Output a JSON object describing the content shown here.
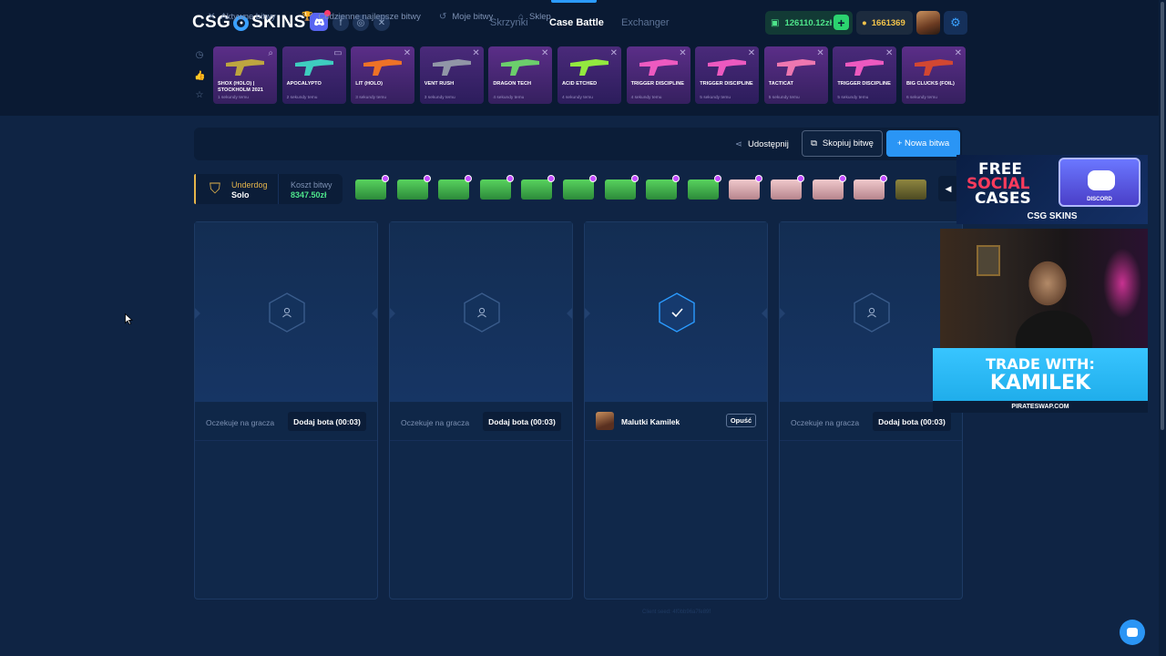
{
  "header": {
    "logo_left": "CSG",
    "logo_right": "SKINS",
    "nav": [
      "Skrzynki",
      "Case Battle",
      "Exchanger"
    ],
    "active_nav": "Case Battle",
    "balance": "126110.12zł",
    "coins": "1661369",
    "social_icons": [
      "discord-icon",
      "facebook-icon",
      "instagram-icon",
      "x-icon"
    ]
  },
  "quick_icons": [
    "clock-icon",
    "thumbs-up-icon",
    "star-icon"
  ],
  "drops": [
    {
      "name": "SHOX (HOLO) | STOCKHOLM 2021",
      "sub": "1 sekundy temu",
      "icon": "pin-icon"
    },
    {
      "name": "APOCALYPTO",
      "sub": "2 sekundy temu",
      "icon": "box-icon"
    },
    {
      "name": "LIT (HOLO)",
      "sub": "3 sekundy temu",
      "icon": "x-icon"
    },
    {
      "name": "VENT RUSH",
      "sub": "3 sekundy temu",
      "icon": "x-icon"
    },
    {
      "name": "DRAGON TECH",
      "sub": "4 sekundy temu",
      "icon": "x-icon"
    },
    {
      "name": "ACID ETCHED",
      "sub": "4 sekundy temu",
      "icon": "x-icon"
    },
    {
      "name": "TRIGGER DISCIPLINE",
      "sub": "4 sekundy temu",
      "icon": "x-icon"
    },
    {
      "name": "TRIGGER DISCIPLINE",
      "sub": "5 sekundy temu",
      "icon": "x-icon"
    },
    {
      "name": "TACTICAT",
      "sub": "5 sekundy temu",
      "icon": "x-icon"
    },
    {
      "name": "TRIGGER DISCIPLINE",
      "sub": "5 sekundy temu",
      "icon": "x-icon"
    },
    {
      "name": "BIG CLUCKS (FOIL)",
      "sub": "6 sekundy temu",
      "icon": "x-icon"
    }
  ],
  "toolbar": {
    "tabs": [
      "Aktywne bitwy",
      "Codzienne najlepsze bitwy",
      "Moje bitwy",
      "Sklep"
    ],
    "share": "Udostępnij",
    "copy": "Skopiuj bitwę",
    "new": "+ Nowa bitwa"
  },
  "battle": {
    "mode": "Underdog",
    "type": "Solo",
    "cost_label": "Koszt bitwy",
    "cost": "8347.50zł",
    "cases": [
      "green",
      "green",
      "green",
      "green",
      "green",
      "green",
      "green",
      "green",
      "green",
      "pink",
      "pink",
      "pink",
      "pink",
      "olive"
    ]
  },
  "slots": [
    {
      "status": "waiting",
      "wait_text": "Oczekuje na gracza",
      "bot_button": "Dodaj bota (00:03)"
    },
    {
      "status": "waiting",
      "wait_text": "Oczekuje na gracza",
      "bot_button": "Dodaj bota (00:03)"
    },
    {
      "status": "joined",
      "player": "Malutki Kamilek",
      "leave": "Opuść"
    },
    {
      "status": "waiting",
      "wait_text": "Oczekuje na gracza",
      "bot_button": "Dodaj bota (00:03)"
    }
  ],
  "footer": {
    "client_seed": "Client seed: 4f0bb96a7fe89f"
  },
  "overlay": {
    "promo_l1": "FREE",
    "promo_l2": "SOCIAL",
    "promo_l3": "CASES",
    "promo_box_brand": "DISCORD",
    "promo_brand": "CSG SKINS",
    "trade_l1": "TRADE WITH:",
    "trade_l2": "KAMILEK",
    "trade_l3": "PIRATESWAP.COM"
  },
  "colors": {
    "accent": "#2a95f5",
    "green": "#4ee58b",
    "gold": "#e5b54b",
    "bg": "#0f2444"
  }
}
